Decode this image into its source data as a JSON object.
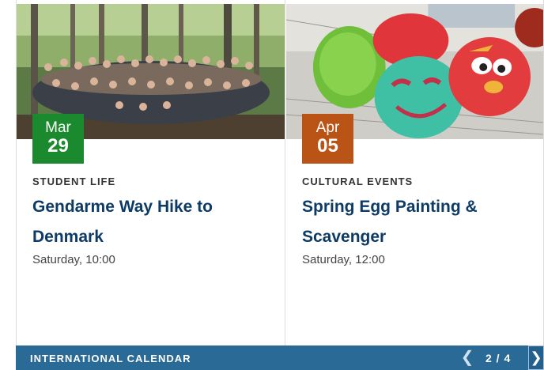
{
  "events": [
    {
      "month": "Mar",
      "day": "29",
      "category": "Student Life",
      "title": "Gendarme Way Hike to Denmark",
      "time": "Saturday, 10:00",
      "badge_color": "#1b8a2e"
    },
    {
      "month": "Apr",
      "day": "05",
      "category": "Cultural Events",
      "title": "Spring Egg Painting & Scavenger",
      "time": "Saturday, 12:00",
      "badge_color": "#b95416"
    }
  ],
  "footer": {
    "title": "International Calendar",
    "pager": "2 / 4",
    "prev_icon": "chevron-left-icon",
    "next_icon": "chevron-right-icon",
    "bar_color": "#2a6a96"
  }
}
